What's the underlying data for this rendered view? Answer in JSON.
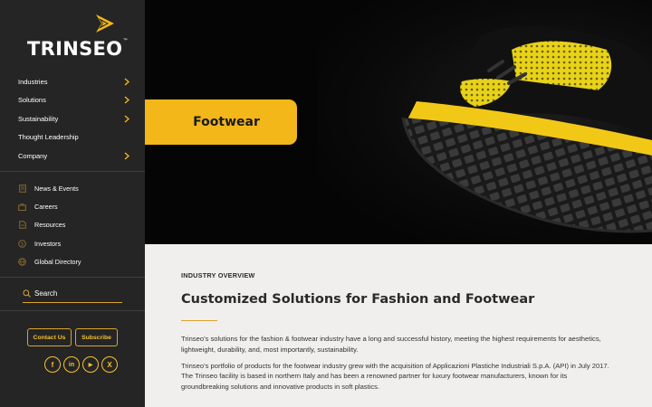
{
  "brand": {
    "name": "TRINSEO",
    "mark": "™"
  },
  "nav": {
    "items": [
      {
        "label": "Industries",
        "has_submenu": true
      },
      {
        "label": "Solutions",
        "has_submenu": true
      },
      {
        "label": "Sustainability",
        "has_submenu": true
      },
      {
        "label": "Thought Leadership",
        "has_submenu": false
      },
      {
        "label": "Company",
        "has_submenu": true
      }
    ]
  },
  "utility": {
    "items": [
      {
        "label": "News & Events",
        "icon": "news-icon"
      },
      {
        "label": "Careers",
        "icon": "briefcase-icon"
      },
      {
        "label": "Resources",
        "icon": "document-icon"
      },
      {
        "label": "Investors",
        "icon": "dollar-icon"
      },
      {
        "label": "Global Directory",
        "icon": "globe-icon"
      }
    ]
  },
  "search": {
    "placeholder": "Search"
  },
  "actions": {
    "contact_label": "Contact Us",
    "subscribe_label": "Subscribe"
  },
  "social": {
    "facebook": "f",
    "linkedin": "in",
    "youtube": "▶",
    "x": "X"
  },
  "hero": {
    "title": "Footwear"
  },
  "overview": {
    "eyebrow": "INDUSTRY OVERVIEW",
    "headline": "Customized Solutions for Fashion and Footwear",
    "paragraphs": [
      "Trinseo’s solutions for the fashion & footwear industry have a long and successful history, meeting the highest requirements for aesthetics, lightweight, durability, and, most importantly, sustainability.",
      "Trinseo’s portfolio of products for the footwear industry grew with the acquisition of Applicazioni Plastiche Industriali S.p.A. (API) in July 2017. The Trinseo facility is based in northern Italy and has been a renowned partner for luxury footwear manufacturers, known for its groundbreaking solutions and innovative products in soft plastics."
    ]
  },
  "colors": {
    "accent": "#f4b71a",
    "sidebar": "#252525",
    "content_bg": "#f0efed"
  }
}
